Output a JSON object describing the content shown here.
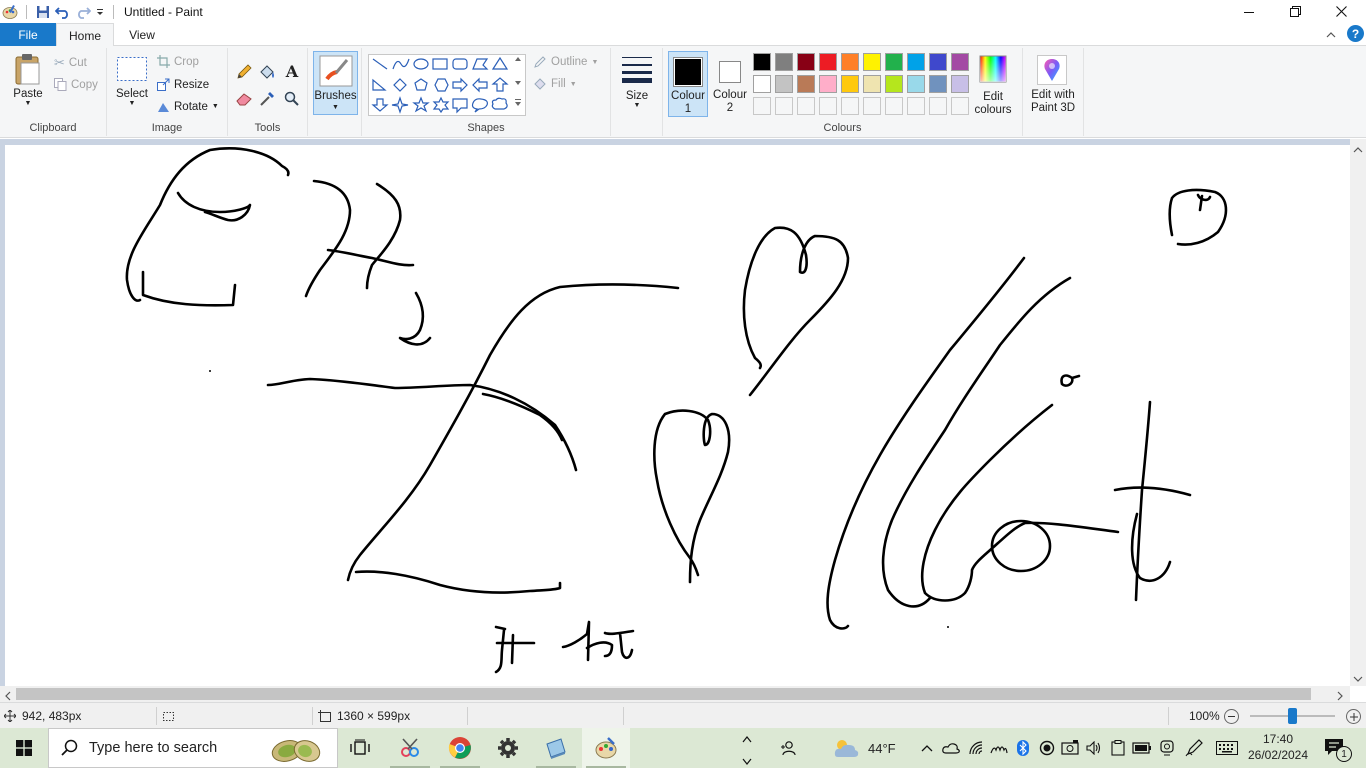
{
  "window": {
    "title": "Untitled - Paint"
  },
  "menu": {
    "file": "File",
    "home": "Home",
    "view": "View"
  },
  "clipboard": {
    "paste": "Paste",
    "cut": "Cut",
    "copy": "Copy",
    "group_label": "Clipboard"
  },
  "image": {
    "select": "Select",
    "crop": "Crop",
    "resize": "Resize",
    "rotate": "Rotate",
    "group_label": "Image"
  },
  "tools": {
    "group_label": "Tools",
    "text_tool": "A"
  },
  "brushes": {
    "label": "Brushes"
  },
  "shapes": {
    "outline": "Outline",
    "fill": "Fill",
    "group_label": "Shapes"
  },
  "size": {
    "label": "Size"
  },
  "colours": {
    "colour1": "Colour 1",
    "colour2": "Colour 2",
    "edit_colours": "Edit colours",
    "edit_paint3d": "Edit with Paint 3D",
    "group_label": "Colours",
    "colour1_value": "#000000",
    "colour2_value": "#ffffff",
    "palette_row1": [
      "#000000",
      "#7f7f7f",
      "#880015",
      "#ed1c24",
      "#ff7f27",
      "#fff200",
      "#22b14c",
      "#00a2e8",
      "#3f48cc",
      "#a349a4"
    ],
    "palette_row2": [
      "#ffffff",
      "#c3c3c3",
      "#b97a57",
      "#ffaec9",
      "#ffc90e",
      "#efe4b0",
      "#b5e61d",
      "#99d9ea",
      "#7092be",
      "#c8bfe7"
    ]
  },
  "status": {
    "cursor_pos": "942, 483px",
    "canvas_size": "1360 × 599px",
    "zoom": "100%",
    "zoom_fraction": 0.5
  },
  "taskbar": {
    "search_placeholder": "Type here to search",
    "weather": "44°F",
    "time": "17:40",
    "date": "26/02/2024",
    "notifications": "1"
  }
}
